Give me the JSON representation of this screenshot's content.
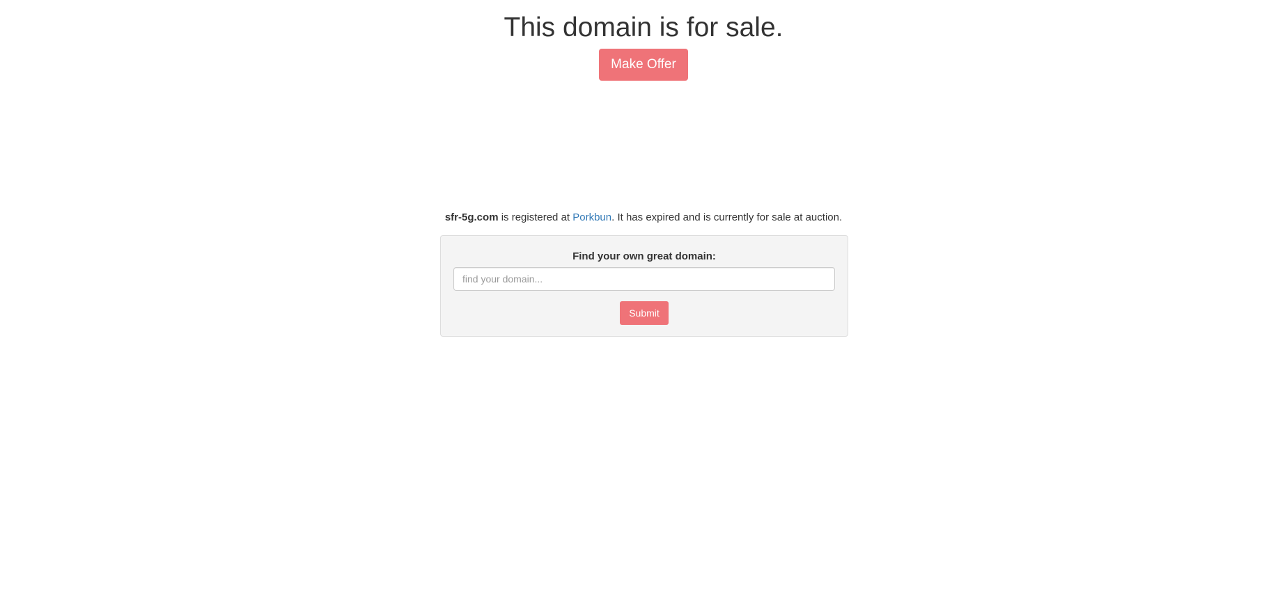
{
  "hero": {
    "headline": "This domain is for sale.",
    "offer_button_label": "Make Offer"
  },
  "registration": {
    "domain_name": "sfr-5g.com",
    "text_before_registrar": " is registered at ",
    "registrar_link": "Porkbun",
    "text_after_registrar": ". It has expired and is currently for sale at auction."
  },
  "search": {
    "label": "Find your own great domain:",
    "placeholder": "find your domain...",
    "value": "",
    "submit_label": "Submit"
  },
  "colors": {
    "accent": "#ef7378",
    "link": "#337ab7",
    "panel_background": "#f4f4f4",
    "text": "#333333"
  }
}
